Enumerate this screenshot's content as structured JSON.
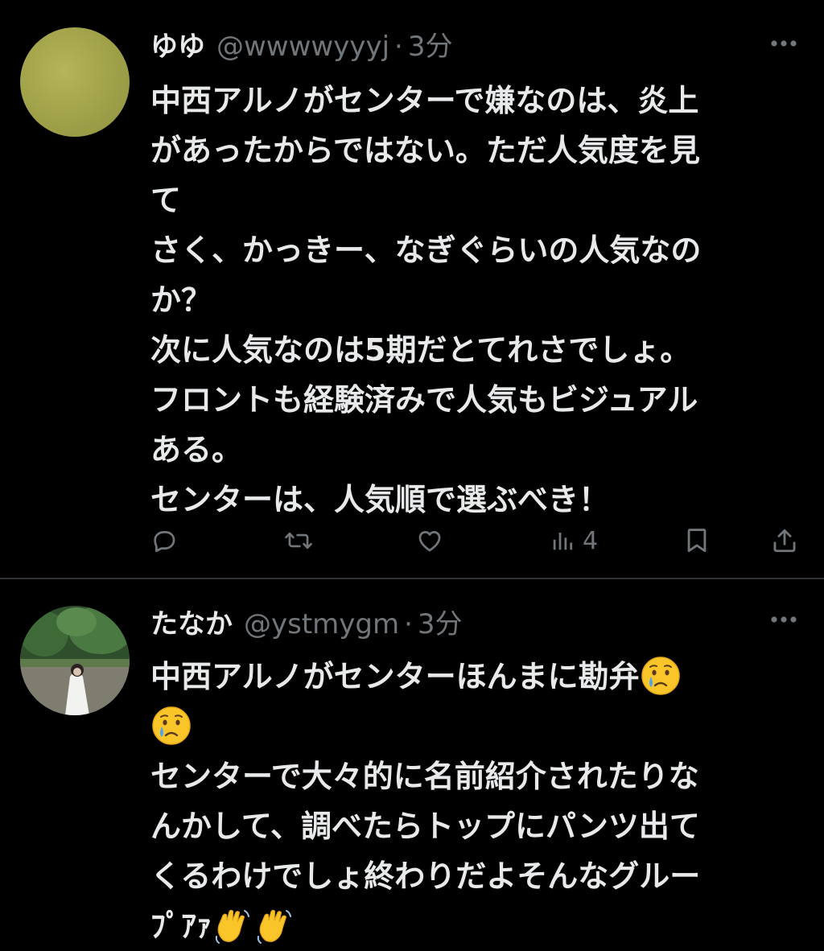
{
  "tweets": [
    {
      "name": "ゆゆ",
      "handle": "@wwwwyyyj",
      "separator": "·",
      "time": "3分",
      "lines": [
        "中西アルノがセンターで嫌なのは、炎上",
        "があったからではない。ただ人気度を見",
        "て",
        "さく、かっきー、なぎぐらいの人気なの",
        "か？",
        "次に人気なのは5期だとてれさでしょ。",
        "フロントも経験済みで人気もビジュアル",
        "ある。",
        "センターは、人気順で選ぶべき！"
      ],
      "actions": {
        "reply_icon": "reply-icon",
        "retweet_icon": "retweet-icon",
        "like_icon": "heart-icon",
        "views_icon": "views-icon",
        "views_count": "4",
        "bookmark_icon": "bookmark-icon",
        "share_icon": "share-icon"
      }
    },
    {
      "name": "たなか",
      "handle": "@ystmygm",
      "separator": "·",
      "time": "3分",
      "lines": [
        "中西アルノがセンターほんまに勘弁",
        "",
        "センターで大々的に名前紹介されたりな",
        "んかして、調べたらトップにパンツ出て",
        "くるわけでしょ終わりだよそんなグルー",
        "ﾌﾟｱｧ"
      ],
      "emojis": [
        "crying-face",
        "crying-face",
        "waving-hand",
        "waving-hand"
      ]
    }
  ],
  "colors": {
    "background": "#000000",
    "text": "#e7e9ea",
    "secondary": "#71767b",
    "divider": "#2f3336"
  }
}
